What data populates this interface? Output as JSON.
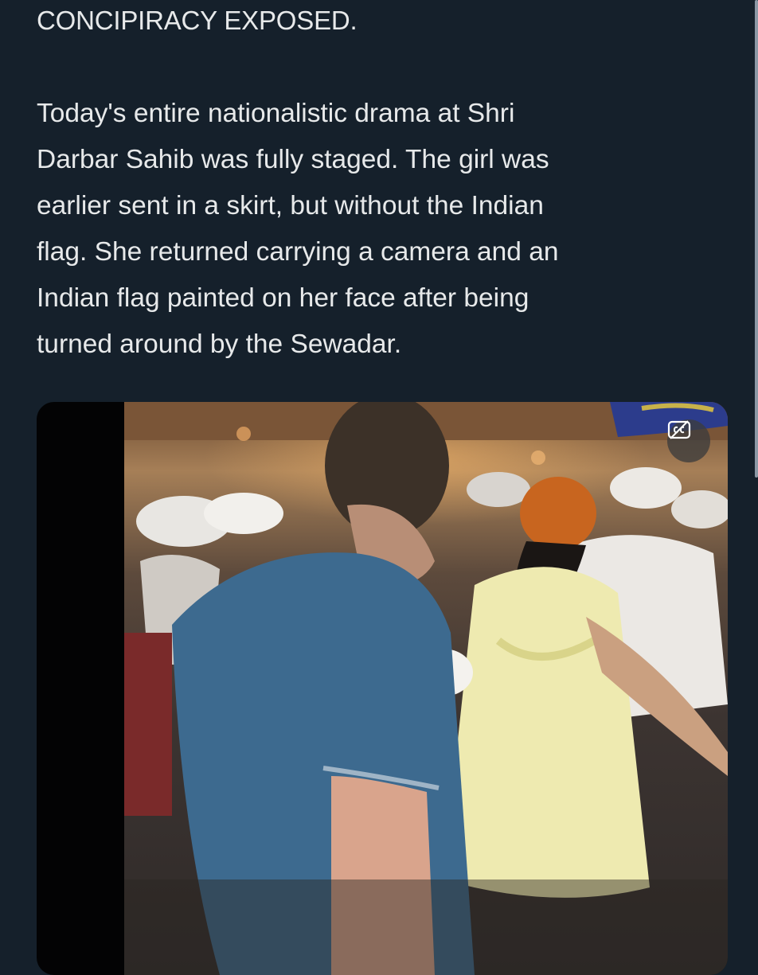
{
  "post": {
    "heading": "CONCIPIRACY EXPOSED.",
    "body_lines": [
      "Today's entire nationalistic drama at Shri",
      "Darbar Sahib was fully staged. The girl was",
      "earlier sent in a skirt, but without the Indian",
      "flag. She returned carrying a camera and an",
      "Indian flag painted on her face after being",
      "turned around by the Sewadar."
    ]
  },
  "media": {
    "type": "video",
    "captions_icon": "closed-captions-icon"
  },
  "colors": {
    "background": "#15202b",
    "text": "#e7e9ea"
  }
}
